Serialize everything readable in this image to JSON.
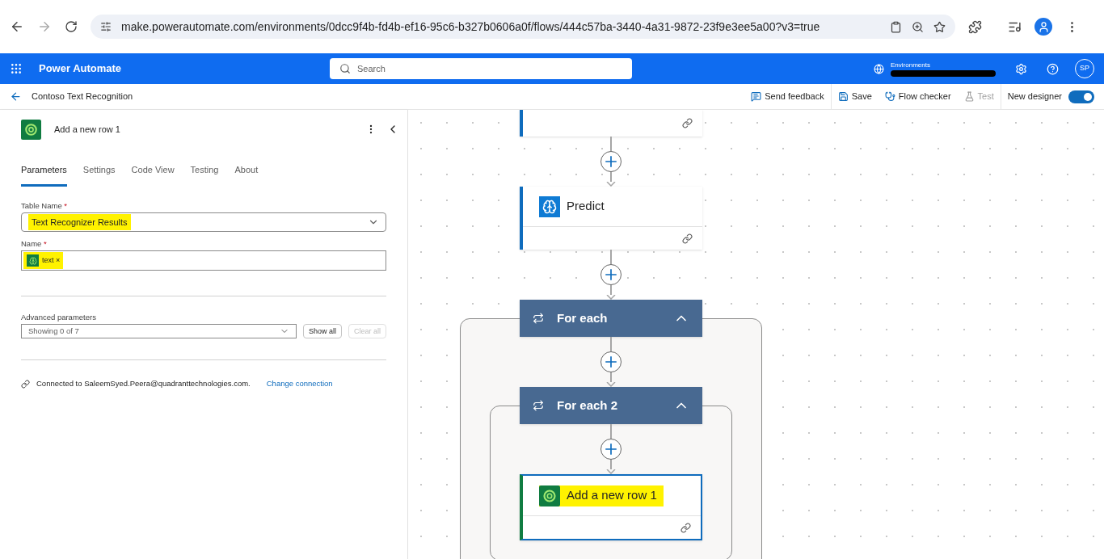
{
  "browser": {
    "url": "make.powerautomate.com/environments/0dcc9f4b-fd4b-ef16-95c6-b327b0606a0f/flows/444c57ba-3440-4a31-9872-23f9e3ee5a00?v3=true"
  },
  "app_bar": {
    "title": "Power Automate",
    "search_placeholder": "Search",
    "environments_label": "Environments",
    "avatar": "SP"
  },
  "subheader": {
    "flow_name": "Contoso Text Recognition",
    "actions": [
      {
        "label": "Send feedback",
        "kind": "feedback",
        "disabled": false
      },
      {
        "label": "Save",
        "kind": "save",
        "disabled": false
      },
      {
        "label": "Flow checker",
        "kind": "checker",
        "disabled": false
      },
      {
        "label": "Test",
        "kind": "test",
        "disabled": true
      }
    ],
    "new_designer": {
      "label": "New designer",
      "on": true
    }
  },
  "panel": {
    "title": "Add a new row 1",
    "tabs": [
      {
        "label": "Parameters",
        "selected": true
      },
      {
        "label": "Settings",
        "selected": false
      },
      {
        "label": "Code View",
        "selected": false
      },
      {
        "label": "Testing",
        "selected": false
      },
      {
        "label": "About",
        "selected": false
      }
    ],
    "table_name": {
      "label": "Table Name",
      "required_mark": "*",
      "value": "Text Recognizer Results",
      "highlighted": true
    },
    "name": {
      "label": "Name",
      "required_mark": "*",
      "token": "text",
      "remove": "×",
      "highlighted": true
    },
    "advanced": {
      "label": "Advanced parameters",
      "value": "Showing 0 of 7",
      "buttons": [
        {
          "label": "Show all",
          "disabled": false
        },
        {
          "label": "Clear all",
          "disabled": true
        }
      ]
    },
    "connection": {
      "text": "Connected to SaleemSyed.Peera@quadranttechnologies.com.",
      "link": "Change connection"
    }
  },
  "canvas": {
    "steps": [
      {
        "kind": "tail",
        "color": "#0f6cbd"
      },
      {
        "kind": "ai_action",
        "title": "Predict",
        "color": "#0f6cbd",
        "selected": false,
        "highlighted": false
      },
      {
        "kind": "loop",
        "title": "For each",
        "expanded": true,
        "children": [
          {
            "kind": "loop",
            "title": "For each 2",
            "expanded": true,
            "children": [
              {
                "kind": "dataverse_action",
                "title": "Add a new row 1",
                "color": "#107c41",
                "selected": true,
                "highlighted": true
              }
            ]
          }
        ]
      }
    ]
  }
}
